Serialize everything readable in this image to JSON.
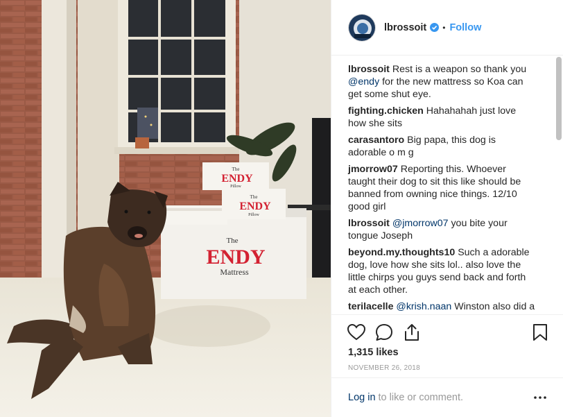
{
  "post": {
    "username": "lbrossoit",
    "follow_label": "Follow",
    "separator": "•",
    "likes": "1,315 likes",
    "date": "NOVEMBER 26, 2018"
  },
  "photo": {
    "box_large_the": "The",
    "box_large_brand": "ENDY",
    "box_large_product": "Mattress",
    "box_small_the": "The",
    "box_small_brand": "ENDY",
    "box_small_product": "Pillow"
  },
  "comments": [
    {
      "user": "lbrossoit",
      "pre": "Rest is a weapon so thank you ",
      "mention": "@endy",
      "post": " for the new mattress so Koa can get some shut eye."
    },
    {
      "user": "fighting.chicken",
      "pre": "Hahahahah just love how she sits",
      "mention": "",
      "post": ""
    },
    {
      "user": "carasantoro",
      "pre": "Big papa, this dog is adorable o m g",
      "mention": "",
      "post": ""
    },
    {
      "user": "jmorrow07",
      "pre": "Reporting this. Whoever taught their dog to sit this like should be banned from owning nice things. 12/10 good girl",
      "mention": "",
      "post": ""
    },
    {
      "user": "lbrossoit",
      "pre": "",
      "mention": "@jmorrow07",
      "post": " you bite your tongue Joseph"
    },
    {
      "user": "beyond.my.thoughts10",
      "pre": "Such a adorable dog, love how she sits lol.. also love the little chirps you guys send back and forth at each other.",
      "mention": "",
      "post": ""
    },
    {
      "user": "terilacelle",
      "pre": "",
      "mention": "@krish.naan",
      "post": " Winston also did a"
    }
  ],
  "footer": {
    "login_link": "Log in",
    "login_rest": "to like or comment."
  },
  "colors": {
    "accent": "#3897f0",
    "link": "#003569",
    "endy_red": "#d32232",
    "muted": "#999999"
  },
  "icons": [
    "verified-badge-icon",
    "heart-icon",
    "comment-icon",
    "share-icon",
    "bookmark-icon",
    "more-options-icon"
  ]
}
